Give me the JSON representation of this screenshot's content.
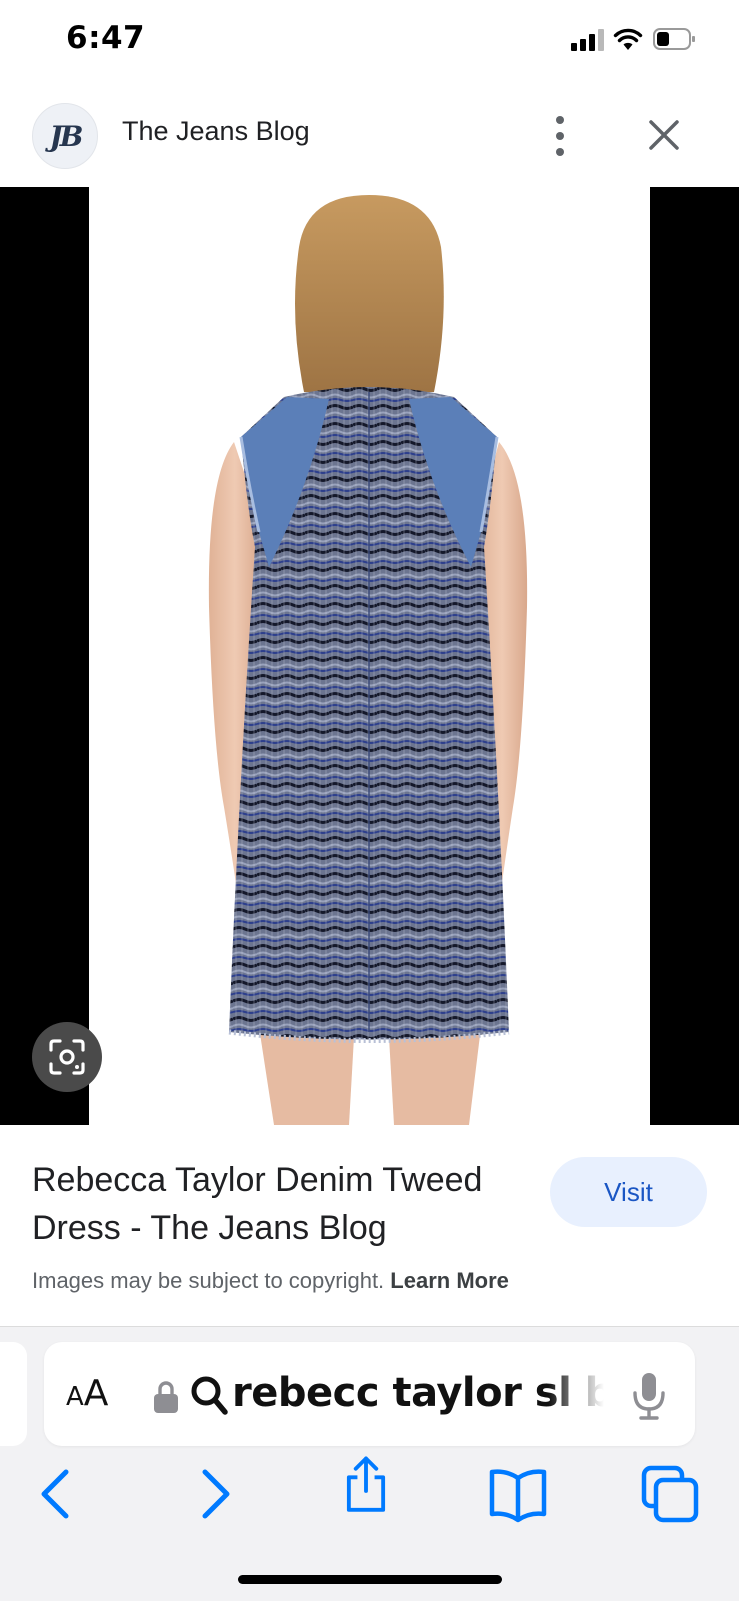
{
  "status_bar": {
    "time": "6:47"
  },
  "source": {
    "avatar_text": "JB",
    "title": "The Jeans Blog"
  },
  "result": {
    "title": "Rebecca Taylor Denim Tweed Dress - The Jeans Blog",
    "visit_label": "Visit",
    "copyright_text": "Images may be subject to copyright.",
    "learn_more": "Learn More"
  },
  "address_bar": {
    "text_size_label": "AA",
    "query": "rebecc taylor sl bo"
  },
  "icons": {
    "status": [
      "signal-icon",
      "wifi-icon",
      "battery-icon"
    ],
    "header": [
      "more-vert-icon",
      "close-icon"
    ],
    "image": [
      "lens-icon"
    ],
    "address_bar": [
      "lock-icon",
      "search-icon",
      "microphone-icon"
    ],
    "toolbar": [
      "back-icon",
      "forward-icon",
      "share-icon",
      "bookmarks-icon",
      "tabs-icon"
    ]
  },
  "colors": {
    "accent": "#007aff",
    "visit_bg": "#e8f0fe",
    "visit_text": "#1a56c4"
  }
}
